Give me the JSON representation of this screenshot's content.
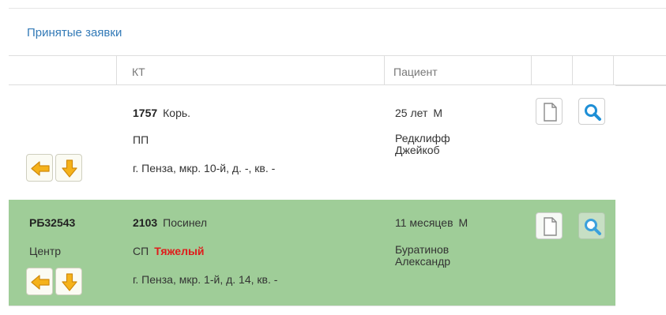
{
  "panel": {
    "title": "Принятые заявки"
  },
  "table": {
    "columns": [
      "КТ",
      "Пациент"
    ],
    "rows": [
      {
        "code": "",
        "dispatch": "",
        "num": "1757",
        "diagnosis": "Корь.",
        "type": "ПП",
        "severity": "",
        "address": "г. Пенза, мкр. 10-й, д. -, кв. -",
        "age": "25 лет",
        "sex": "М",
        "name_line1": "Редклифф",
        "name_line2": "Джейкоб",
        "background": "#ffffff"
      },
      {
        "code": "РБ32543",
        "dispatch": "Центр",
        "num": "2103",
        "diagnosis": "Посинел",
        "type": "СП",
        "severity": "Тяжелый",
        "address": "г. Пенза, мкр. 1-й, д. 14, кв. -",
        "age": "11 месяцев",
        "sex": "М",
        "name_line1": "Буратинов",
        "name_line2": "Александр",
        "background": "#9fcd98"
      }
    ]
  },
  "icons": {
    "document": "document-icon",
    "search": "magnifier-icon",
    "left_arrow": "arrow-left-icon",
    "down_arrow": "arrow-down-icon"
  },
  "colors": {
    "link": "#337ab7",
    "severity": "#e01b1b",
    "arrow_fill": "#f5b21a",
    "search_icon": "#1e8fd6"
  }
}
